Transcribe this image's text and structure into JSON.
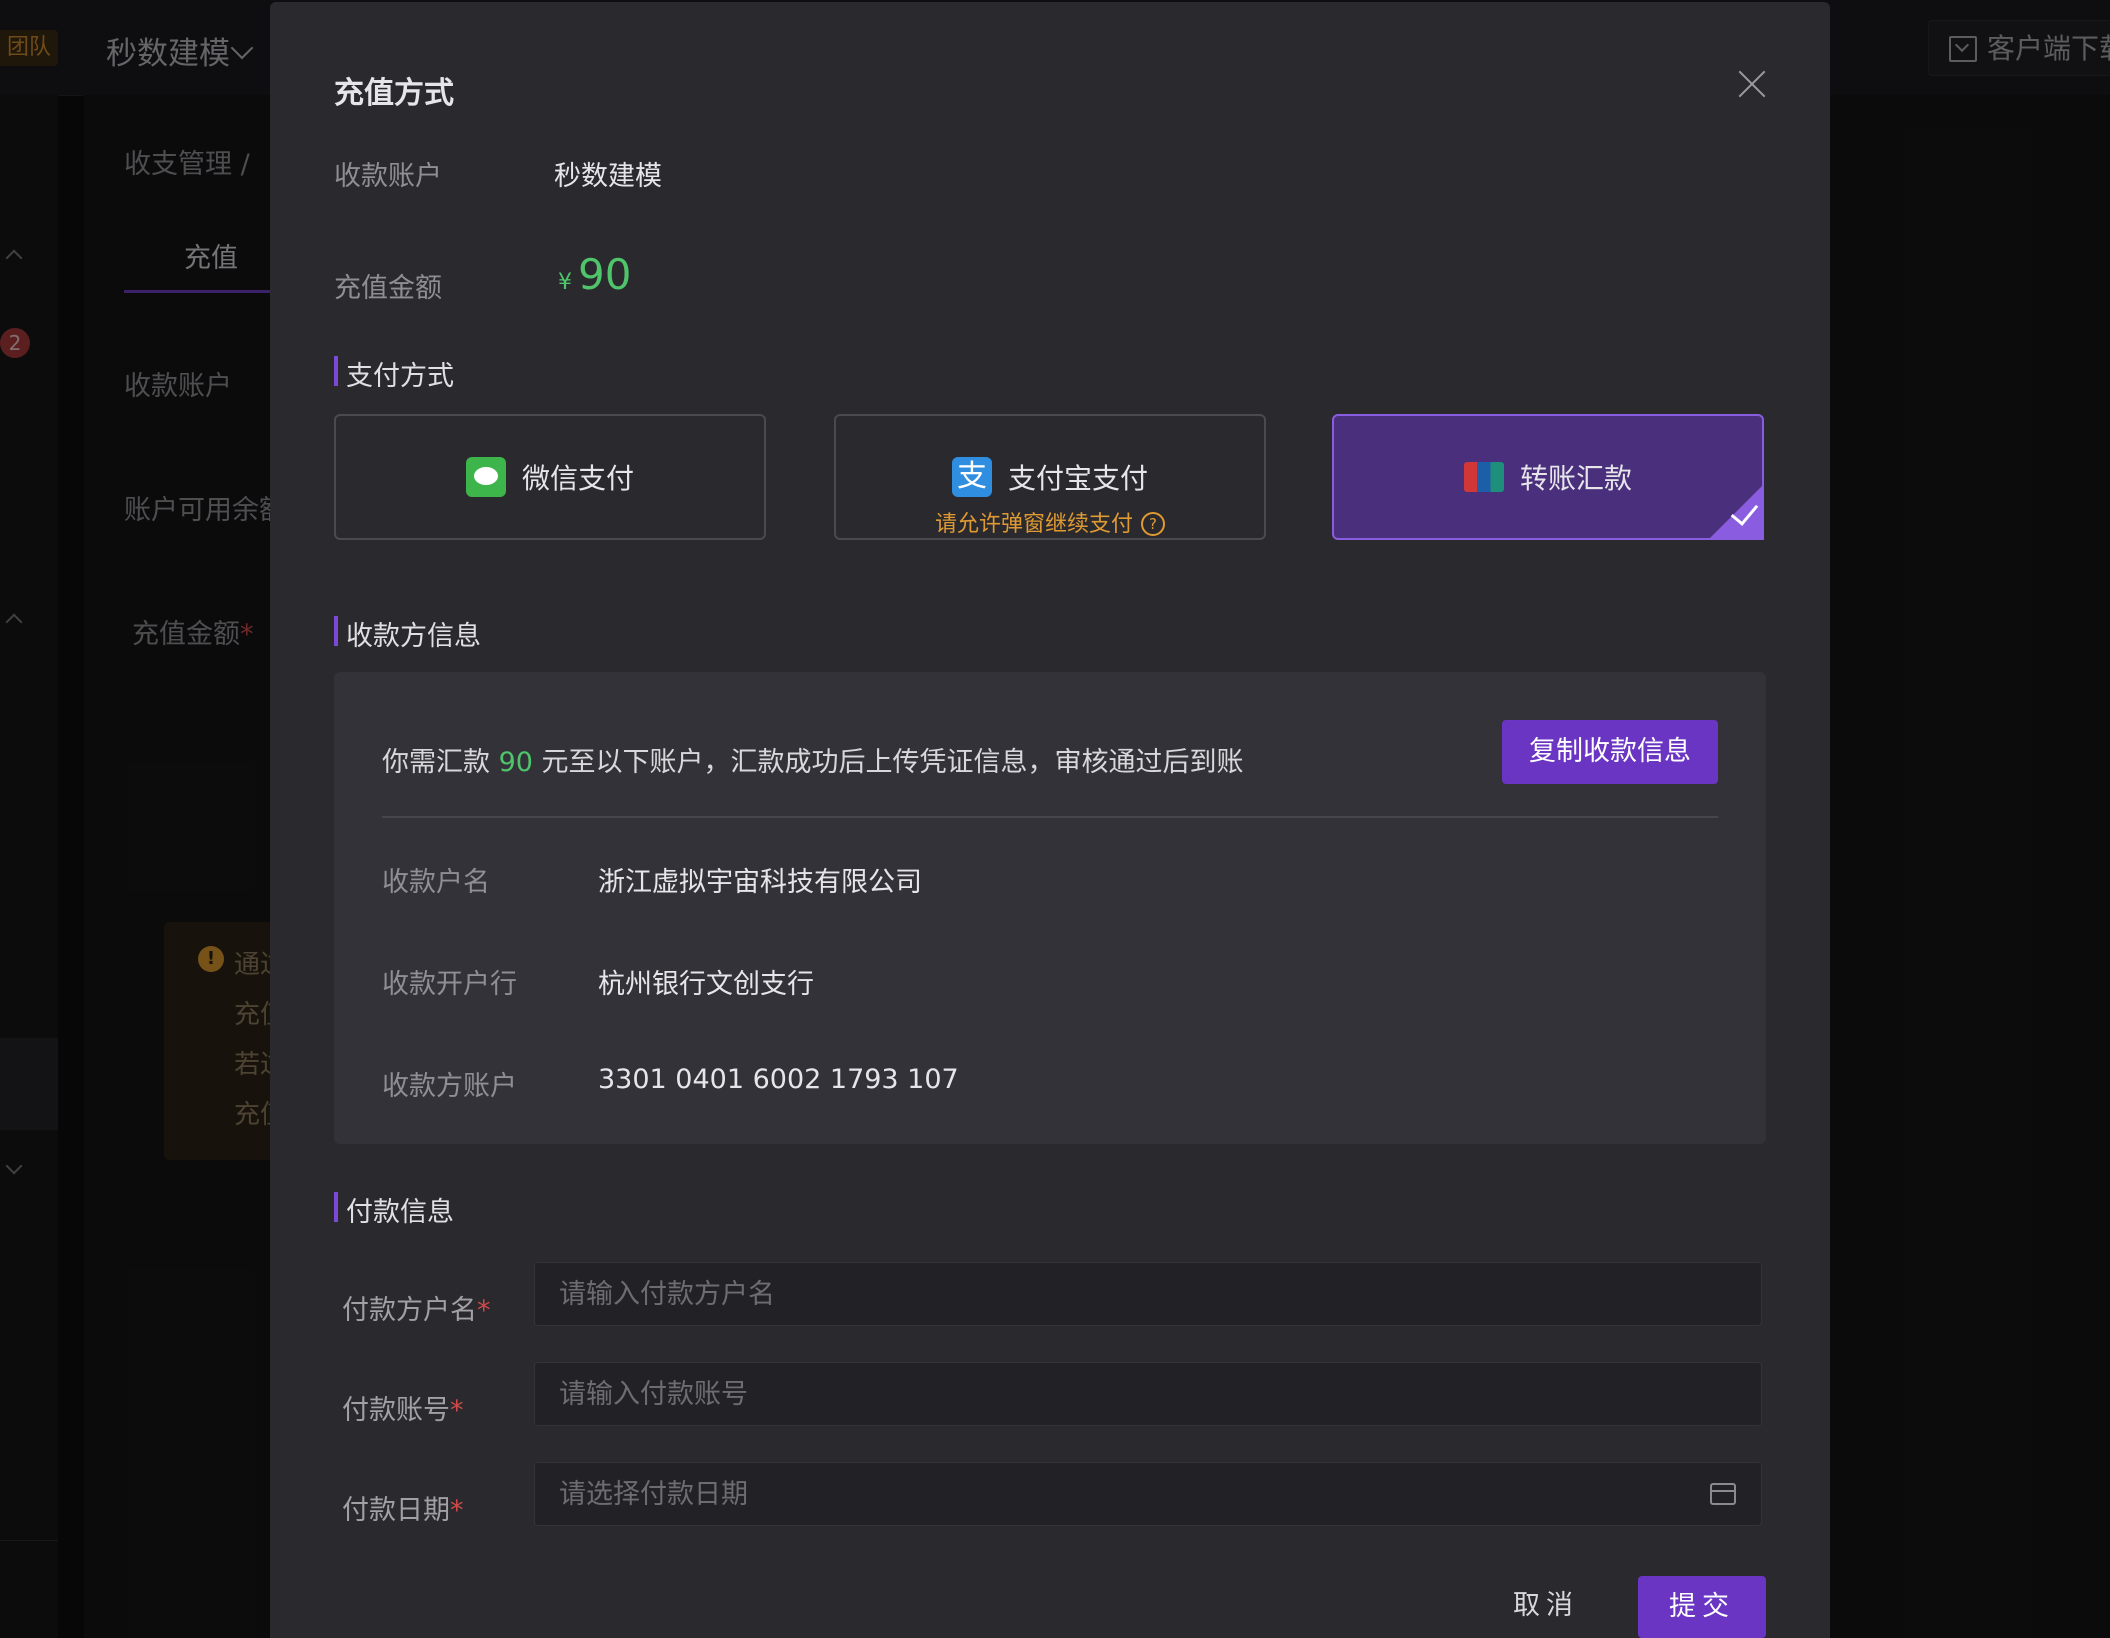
{
  "app": {
    "team_badge": "团队",
    "brand": "秒数建模",
    "download_label": "客户端下载"
  },
  "background": {
    "badge_count": "2",
    "breadcrumb": "收支管理  /",
    "tab_label": "充值",
    "labels": [
      "收款账户",
      "账户可用余额",
      "充值金额"
    ],
    "notice_lines": [
      "通过",
      "充值",
      "若过",
      "充值"
    ]
  },
  "modal": {
    "title": "充值方式",
    "account_label": "收款账户",
    "account_value": "秒数建模",
    "amount_label": "充值金额",
    "currency": "¥",
    "amount": "90",
    "payment_section": "支付方式",
    "methods": [
      {
        "label": "微信支付",
        "icon": "wechat-icon",
        "sub": ""
      },
      {
        "label": "支付宝支付",
        "icon": "alipay-icon",
        "sub": "请允许弹窗继续支付"
      },
      {
        "label": "转账汇款",
        "icon": "unionpay-icon",
        "sub": "",
        "selected": true
      }
    ],
    "payee_section": "收款方信息",
    "payee": {
      "instruction_prefix": "你需汇款",
      "instruction_amount": "90",
      "instruction_suffix": "元至以下账户，汇款成功后上传凭证信息，审核通过后到账",
      "copy_button": "复制收款信息",
      "rows": [
        {
          "label": "收款户名",
          "value": "浙江虚拟宇宙科技有限公司"
        },
        {
          "label": "收款开户行",
          "value": "杭州银行文创支行"
        },
        {
          "label": "收款方账户",
          "value": "3301 0401 6002 1793 107"
        }
      ]
    },
    "payer_section": "付款信息",
    "payer_fields": [
      {
        "label": "付款方户名",
        "placeholder": "请输入付款方户名",
        "required": "*"
      },
      {
        "label": "付款账号",
        "placeholder": "请输入付款账号",
        "required": "*"
      },
      {
        "label": "付款日期",
        "placeholder": "请选择付款日期",
        "required": "*"
      }
    ],
    "cancel": "取消",
    "submit": "提交"
  },
  "colors": {
    "accent": "#6b35c4",
    "amount_green": "#4fc46a",
    "warning_orange": "#e09a33"
  }
}
